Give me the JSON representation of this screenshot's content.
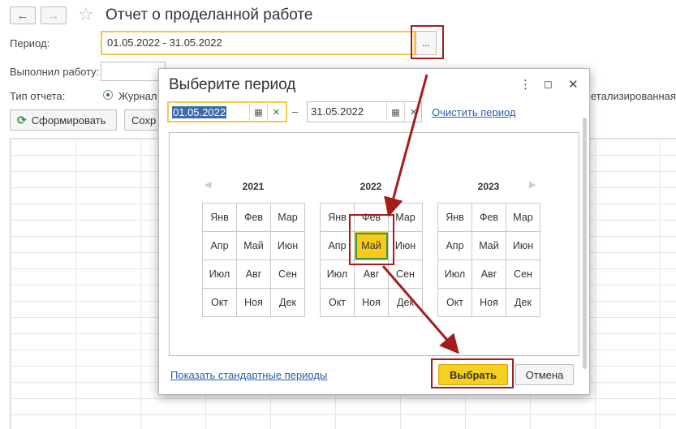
{
  "header": {
    "title": "Отчет о проделанной работе"
  },
  "form": {
    "period_label": "Период:",
    "period_value": "01.05.2022 - 31.05.2022",
    "select_btn": "...",
    "performer_label": "Выполнил работу:",
    "report_type_label": "Тип отчета:",
    "report_type_option1": "Журнал",
    "report_type_option2": "етализированная",
    "generate_btn": "Сформировать",
    "save_btn": "Сохр"
  },
  "dialog": {
    "title": "Выберите период",
    "date_from": "01.05.2022",
    "date_to": "31.05.2022",
    "dash": "–",
    "clear_link": "Очистить период",
    "show_standard_link": "Показать стандартные периоды",
    "ok_btn": "Выбрать",
    "cancel_btn": "Отмена"
  },
  "calendar": {
    "years": [
      "2021",
      "2022",
      "2023"
    ],
    "months": [
      "Янв",
      "Фев",
      "Мар",
      "Апр",
      "Май",
      "Июн",
      "Июл",
      "Авг",
      "Сен",
      "Окт",
      "Ноя",
      "Дек"
    ],
    "selected": {
      "year": "2022",
      "month": "Май"
    }
  },
  "colors": {
    "accent_yellow": "#f7cb1d",
    "highlight_red": "#a51c1c",
    "selection_green": "#3a9a3a",
    "link_blue": "#2a5ea8"
  }
}
